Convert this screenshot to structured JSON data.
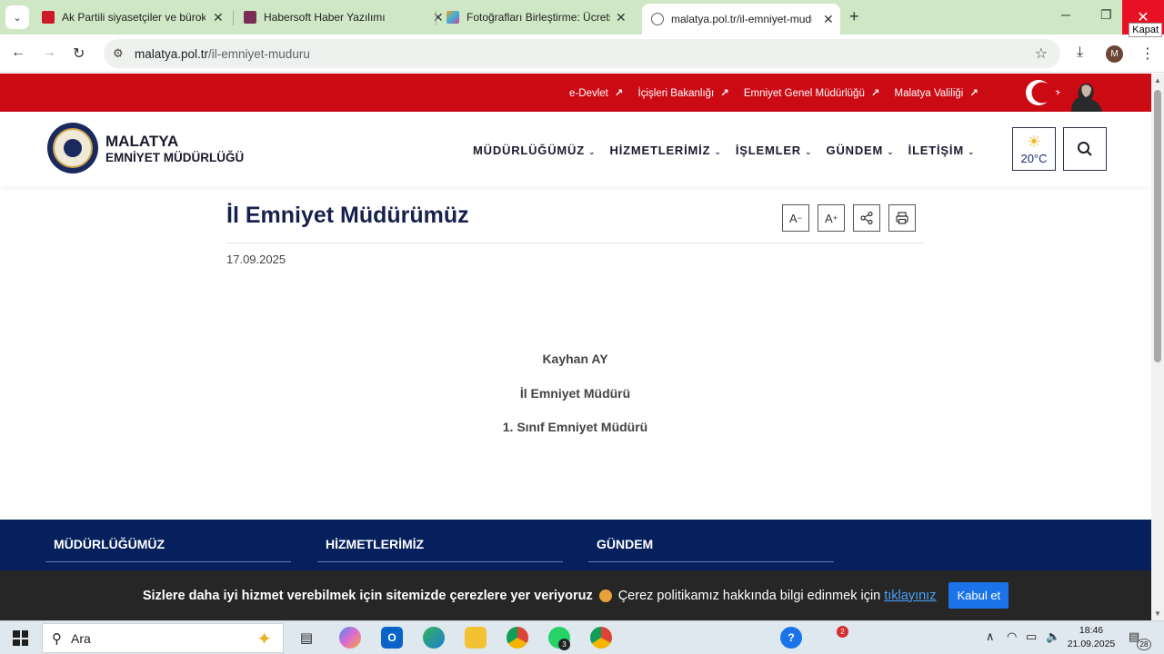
{
  "browser": {
    "tabs": [
      {
        "title": "Ak Partili siyasetçiler ve bürokra",
        "favicon_color": "#d1182b"
      },
      {
        "title": "Habersoft Haber Yazılımı",
        "favicon_color": "#7b2d55"
      },
      {
        "title": "Fotoğrafları Birleştirme: Ücretsiz",
        "favicon_color": "#f0a020"
      },
      {
        "title": "malatya.pol.tr/il-emniyet-mudu",
        "favicon_color": "#5f6368",
        "active": true
      }
    ],
    "close_tooltip": "Kapat",
    "url_host": "malatya.pol.tr",
    "url_path": "/il-emniyet-muduru",
    "profile_initial": "M"
  },
  "site": {
    "top_links": [
      "e-Devlet",
      "İçişleri Bakanlığı",
      "Emniyet Genel Müdürlüğü",
      "Malatya Valiliği"
    ],
    "brand_line1": "MALATYA",
    "brand_line2": "EMNİYET MÜDÜRLÜĞÜ",
    "nav": [
      "MÜDÜRLÜĞÜMÜZ",
      "HİZMETLERİMİZ",
      "İŞLEMLER",
      "GÜNDEM",
      "İLETİŞİM"
    ],
    "weather_temp": "20°C",
    "colors": {
      "red_bar": "#cc0a14",
      "navy": "#06205e",
      "title": "#16224d"
    }
  },
  "content": {
    "title": "İl Emniyet Müdürümüz",
    "date": "17.09.2025",
    "tool_font_decrease": "A",
    "tool_font_increase": "A",
    "name": "Kayhan AY",
    "position": "İl Emniyet Müdürü",
    "rank": "1. Sınıf Emniyet Müdürü"
  },
  "footer": {
    "columns": [
      "MÜDÜRLÜĞÜMÜZ",
      "HİZMETLERİMİZ",
      "GÜNDEM"
    ]
  },
  "cookie": {
    "bold_text": "Sizlere daha iyi hizmet verebilmek için sitemizde çerezlere yer veriyoruz",
    "normal_text": "Çerez politikamız hakkında bilgi edinmek için",
    "link_text": "tıklayınız",
    "accept_label": "Kabul et"
  },
  "taskbar": {
    "search_placeholder": "Ara",
    "chat_badge": "3",
    "notif_badge": "2",
    "time": "18:46",
    "date": "21.09.2025",
    "notification_count": "28"
  }
}
